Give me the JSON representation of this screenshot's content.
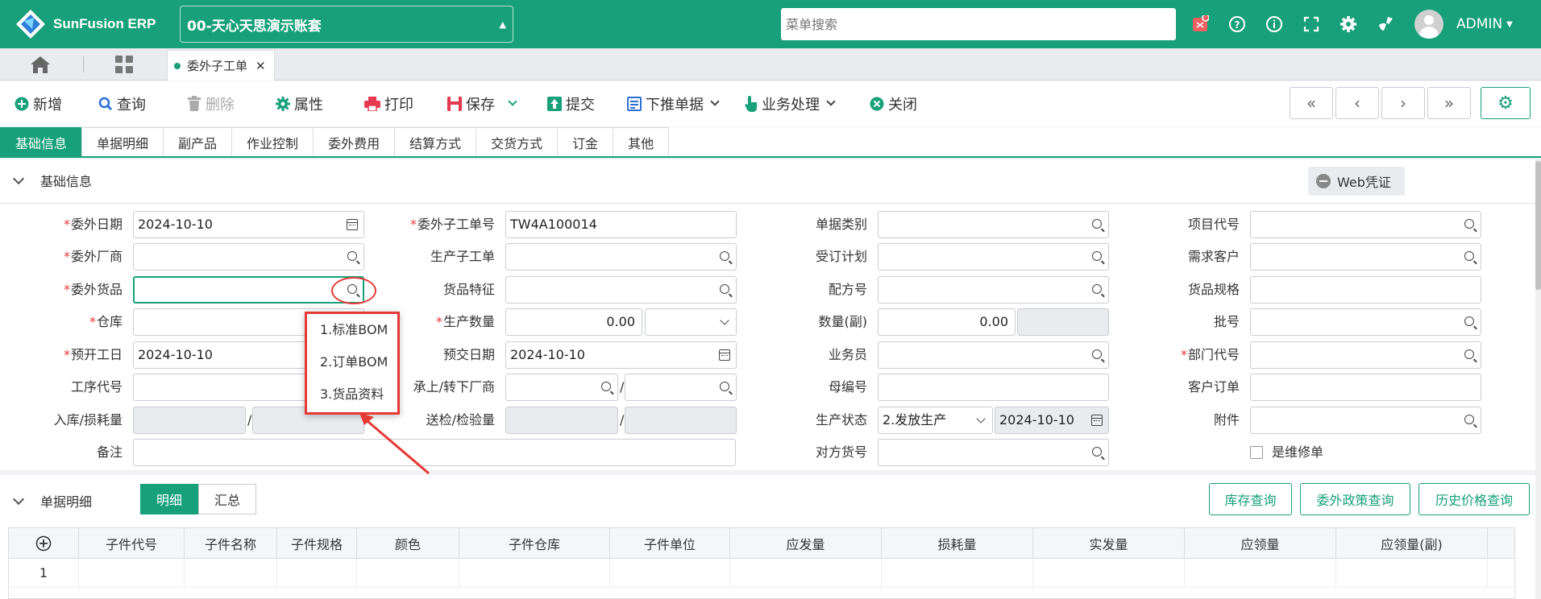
{
  "app": {
    "name": "SunFusion ERP",
    "account": "00-天心天思演示账套",
    "search_placeholder": "菜单搜索",
    "user": "ADMIN"
  },
  "tabs": {
    "active": "委外子工单"
  },
  "toolbar": {
    "add": "新增",
    "query": "查询",
    "delete": "删除",
    "props": "属性",
    "print": "打印",
    "save": "保存",
    "submit": "提交",
    "push": "下推单据",
    "business": "业务处理",
    "close": "关闭"
  },
  "subtabs": [
    "基础信息",
    "单据明细",
    "副产品",
    "作业控制",
    "委外费用",
    "结算方式",
    "交货方式",
    "订金",
    "其他"
  ],
  "section1": {
    "title": "基础信息",
    "web_voucher": "Web凭证"
  },
  "col1": {
    "labels": [
      "委外日期",
      "委外厂商",
      "委外货品",
      "仓库",
      "预开工日",
      "工序代号",
      "入库/损耗量",
      "备注"
    ],
    "date": "2024-10-10",
    "start_date": "2024-10-10"
  },
  "col2": {
    "labels": [
      "委外子工单号",
      "生产子工单",
      "货品特征",
      "生产数量",
      "预交日期",
      "承上/转下厂商",
      "送检/检验量"
    ],
    "order_no": "TW4A100014",
    "qty": "0.00",
    "due_date": "2024-10-10"
  },
  "col3": {
    "labels": [
      "单据类别",
      "受订计划",
      "配方号",
      "数量(副)",
      "业务员",
      "母编号",
      "生产状态",
      "对方货号"
    ],
    "qty2": "0.00",
    "status": "2.发放生产",
    "status_date": "2024-10-10"
  },
  "col4": {
    "labels": [
      "项目代号",
      "需求客户",
      "货品规格",
      "批号",
      "部门代号",
      "客户订单",
      "附件"
    ],
    "repair": "是维修单"
  },
  "popup": {
    "items": [
      "1.标准BOM",
      "2.订单BOM",
      "3.货品资料"
    ]
  },
  "section2": {
    "title": "单据明细",
    "seg_detail": "明细",
    "seg_summary": "汇总",
    "btn_stock": "库存查询",
    "btn_policy": "委外政策查询",
    "btn_price": "历史价格查询"
  },
  "grid": {
    "headers": [
      "子件代号",
      "子件名称",
      "子件规格",
      "颜色",
      "子件仓库",
      "子件单位",
      "应发量",
      "损耗量",
      "实发量",
      "应领量",
      "应领量(副)"
    ],
    "row1": "1"
  },
  "colors": {
    "brand": "#17a07a",
    "required": "#e53935",
    "annotation": "#e53935"
  }
}
